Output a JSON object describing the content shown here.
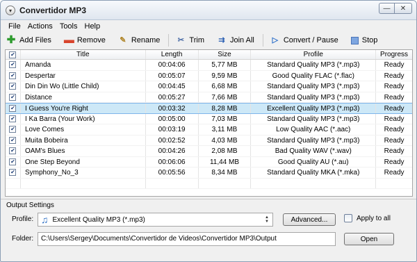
{
  "window": {
    "title": "Convertidor MP3",
    "controls": {
      "minimize": "—",
      "close": "✕"
    }
  },
  "menu": [
    "File",
    "Actions",
    "Tools",
    "Help"
  ],
  "toolbar": {
    "add_files": "Add Files",
    "remove": "Remove",
    "rename": "Rename",
    "trim": "Trim",
    "join_all": "Join All",
    "convert_pause": "Convert / Pause",
    "stop": "Stop"
  },
  "table": {
    "columns": [
      "Title",
      "Length",
      "Size",
      "Profile",
      "Progress"
    ],
    "rows": [
      {
        "title": "Amanda",
        "length": "00:04:06",
        "size": "5,77 MB",
        "profile": "Standard Quality MP3 (*.mp3)",
        "progress": "Ready",
        "checked": true
      },
      {
        "title": "Despertar",
        "length": "00:05:07",
        "size": "9,59 MB",
        "profile": "Good Quality FLAC (*.flac)",
        "progress": "Ready",
        "checked": true
      },
      {
        "title": "Din Din Wo (Little Child)",
        "length": "00:04:45",
        "size": "6,68 MB",
        "profile": "Standard Quality MP3 (*.mp3)",
        "progress": "Ready",
        "checked": true
      },
      {
        "title": "Distance",
        "length": "00:05:27",
        "size": "7,66 MB",
        "profile": "Standard Quality MP3 (*.mp3)",
        "progress": "Ready",
        "checked": true
      },
      {
        "title": "I Guess You're Right",
        "length": "00:03:32",
        "size": "8,28 MB",
        "profile": "Excellent Quality MP3 (*.mp3)",
        "progress": "Ready",
        "checked": true,
        "selected": true
      },
      {
        "title": "I Ka Barra (Your Work)",
        "length": "00:05:00",
        "size": "7,03 MB",
        "profile": "Standard Quality MP3 (*.mp3)",
        "progress": "Ready",
        "checked": true
      },
      {
        "title": "Love Comes",
        "length": "00:03:19",
        "size": "3,11 MB",
        "profile": "Low Quality AAC (*.aac)",
        "progress": "Ready",
        "checked": true
      },
      {
        "title": "Muita Bobeira",
        "length": "00:02:52",
        "size": "4,03 MB",
        "profile": "Standard Quality MP3 (*.mp3)",
        "progress": "Ready",
        "checked": true
      },
      {
        "title": "OAM's Blues",
        "length": "00:04:26",
        "size": "2,08 MB",
        "profile": "Bad Quality WAV (*.wav)",
        "progress": "Ready",
        "checked": true
      },
      {
        "title": "One Step Beyond",
        "length": "00:06:06",
        "size": "11,44 MB",
        "profile": "Good Quality AU (*.au)",
        "progress": "Ready",
        "checked": true
      },
      {
        "title": "Symphony_No_3",
        "length": "00:05:56",
        "size": "8,34 MB",
        "profile": "Standard Quality MKA (*.mka)",
        "progress": "Ready",
        "checked": true
      }
    ]
  },
  "output": {
    "section_label": "Output Settings",
    "profile_label": "Profile:",
    "profile_value": "Excellent Quality MP3 (*.mp3)",
    "advanced_button": "Advanced...",
    "apply_to_all": "Apply to all",
    "folder_label": "Folder:",
    "folder_value": "C:\\Users\\Sergey\\Documents\\Convertidor de Videos\\Convertidor MP3\\Output",
    "open_button": "Open"
  },
  "icons": {
    "add": "add-icon",
    "remove": "remove-icon",
    "rename": "rename-icon",
    "trim": "scissors-icon",
    "join": "join-icon",
    "convert": "play-icon",
    "stop": "stop-icon",
    "profile": "music-note-icon"
  },
  "colors": {
    "selection": "#cde8f7",
    "selection_border": "#7eb4ea"
  }
}
